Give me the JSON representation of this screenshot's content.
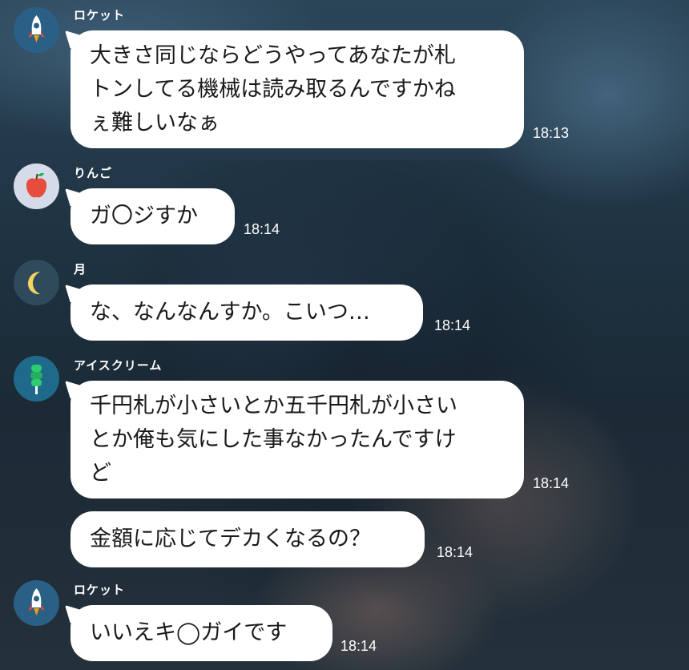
{
  "messages": [
    {
      "sender": "ロケット",
      "avatar": "rocket-icon",
      "text": "大きさ同じならどうやってあなたが札\nトンしてる機械は読み取るんですかね\nぇ難しいなぁ",
      "time": "18:13"
    },
    {
      "sender": "りんご",
      "avatar": "apple-icon",
      "text": "ガ〇ジすか",
      "time": "18:14"
    },
    {
      "sender": "月",
      "avatar": "moon-icon",
      "text": "な、なんなんすか。こいつ…",
      "time": "18:14"
    },
    {
      "sender": "アイスクリーム",
      "avatar": "ice-cream-icon",
      "text": "千円札が小さいとか五千円札が小さい\nとか俺も気にした事なかったんですけ\nど",
      "time": "18:14"
    },
    {
      "sender": "",
      "avatar": "",
      "text": "金額に応じてデカくなるの？",
      "time": "18:14"
    },
    {
      "sender": "ロケット",
      "avatar": "rocket-icon",
      "text": "いいえキ◯ガイです",
      "time": "18:14"
    }
  ],
  "colors": {
    "bubble": "#ffffff",
    "text": "#1a1a1a",
    "meta_text": "#ffffff"
  }
}
